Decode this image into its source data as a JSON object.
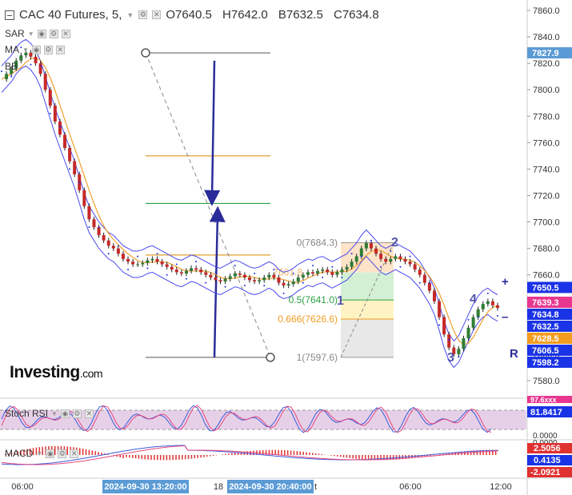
{
  "header": {
    "title": "CAC 40 Futures, 5,",
    "open": "O7640.5",
    "high": "H7642.0",
    "bid": "B7632.5",
    "close": "C7634.8"
  },
  "indicators": {
    "sar": "SAR",
    "ma": "MA",
    "bb": "BB",
    "stoch_rsi": "Stoch RSI",
    "macd": "MACD"
  },
  "branding": {
    "logo": "Investing",
    "logo_suffix": ".com"
  },
  "price_axis": {
    "ticks": [
      "7860.0",
      "7840.0",
      "7820.0",
      "7800.0",
      "7780.0",
      "7760.0",
      "7740.0",
      "7720.0",
      "7700.0",
      "7680.0",
      "7660.0",
      "7640.0",
      "7620.0",
      "7600.0",
      "7580.0"
    ]
  },
  "price_tags": [
    {
      "label": "7827.9",
      "value": 7827.9,
      "color": "#5b9bd5"
    },
    {
      "label": "7650.5",
      "value": 7650.5,
      "color": "#1a33e6"
    },
    {
      "label": "7639.3",
      "value": 7639.3,
      "color": "#e8368f"
    },
    {
      "label": "7634.8",
      "value": 7634.8,
      "color": "#1a33e6"
    },
    {
      "label": "7632.5",
      "value": 7632.5,
      "color": "#1a33e6"
    },
    {
      "label": "7628.5",
      "value": 7628.5,
      "color": "#f39c1f"
    },
    {
      "label": "7606.5",
      "value": 7606.5,
      "color": "#1a33e6"
    },
    {
      "label": "7598.2",
      "value": 7598.2,
      "color": "#1a33e6"
    }
  ],
  "fib_labels": [
    "0(7684.3)",
    "0.5(7641.0)",
    "0.666(7626.6)",
    "1(7597.6)",
    "7661.8"
  ],
  "wave_labels": [
    "1",
    "2",
    "3",
    "4"
  ],
  "marks": {
    "plus": "+",
    "minus": "–",
    "r": "R"
  },
  "stoch_axis": {
    "top": "81.8417",
    "bottom": "0.0000",
    "cut": "97.6xxx"
  },
  "macd_axis": {
    "v1": "2.5056",
    "v2": "0.4135",
    "v3": "-2.0921",
    "top": "0.0000"
  },
  "time_axis": {
    "ticks": [
      "06:00",
      "18",
      "06:00",
      "12:00"
    ],
    "tail": "t",
    "cursor_a": "2024-09-30 13:20:00",
    "cursor_b": "2024-09-30 20:40:00"
  },
  "colors": {
    "up": "#2e7d32",
    "down": "#c62828",
    "bb": "#4a4af0",
    "ma": "#f0a030",
    "sar": "#1a33e6"
  },
  "chart_data": {
    "type": "line",
    "title": "CAC 40 Futures, 5,",
    "xlabel": "",
    "ylabel": "",
    "ylim": [
      7570,
      7870
    ],
    "x_ticks": [
      "06:00",
      "18",
      "06:00",
      "12:00"
    ],
    "series": [
      {
        "values": [
          7808,
          7812,
          7816,
          7822,
          7826,
          7828,
          7825,
          7820,
          7812,
          7800,
          7788,
          7776,
          7766,
          7756,
          7746,
          7736,
          7724,
          7712,
          7702,
          7696,
          7690,
          7686,
          7682,
          7680,
          7676,
          7672,
          7670,
          7668,
          7668,
          7669,
          7671,
          7672,
          7670,
          7668,
          7666,
          7664,
          7662,
          7661,
          7663,
          7665,
          7664,
          7662,
          7660,
          7658,
          7656,
          7655,
          7657,
          7659,
          7661,
          7660,
          7658,
          7656,
          7655,
          7656,
          7658,
          7660,
          7658,
          7654,
          7652,
          7653,
          7655,
          7658,
          7660,
          7662,
          7661,
          7663,
          7664,
          7662,
          7660,
          7662,
          7664,
          7666,
          7670,
          7674,
          7680,
          7684,
          7680,
          7676,
          7672,
          7670,
          7672,
          7674,
          7672,
          7670,
          7668,
          7664,
          7660,
          7654,
          7648,
          7640,
          7628,
          7615,
          7605,
          7600,
          7604,
          7612,
          7620,
          7628,
          7634,
          7638,
          7640,
          7637,
          7635
        ]
      }
    ],
    "fibonacci": {
      "levels": [
        {
          "ratio": 0,
          "value": 7684.3
        },
        {
          "ratio": 0.5,
          "value": 7641.0
        },
        {
          "ratio": 0.666,
          "value": 7626.6
        },
        {
          "ratio": 1,
          "value": 7597.6
        }
      ]
    },
    "horizontal_levels": [
      7827.9,
      7750,
      7714,
      7675,
      7597.6
    ],
    "stoch_rsi": {
      "value": 81.8417
    },
    "macd": {
      "macd": 2.5056,
      "signal": 0.4135,
      "histogram": -2.0921
    }
  }
}
